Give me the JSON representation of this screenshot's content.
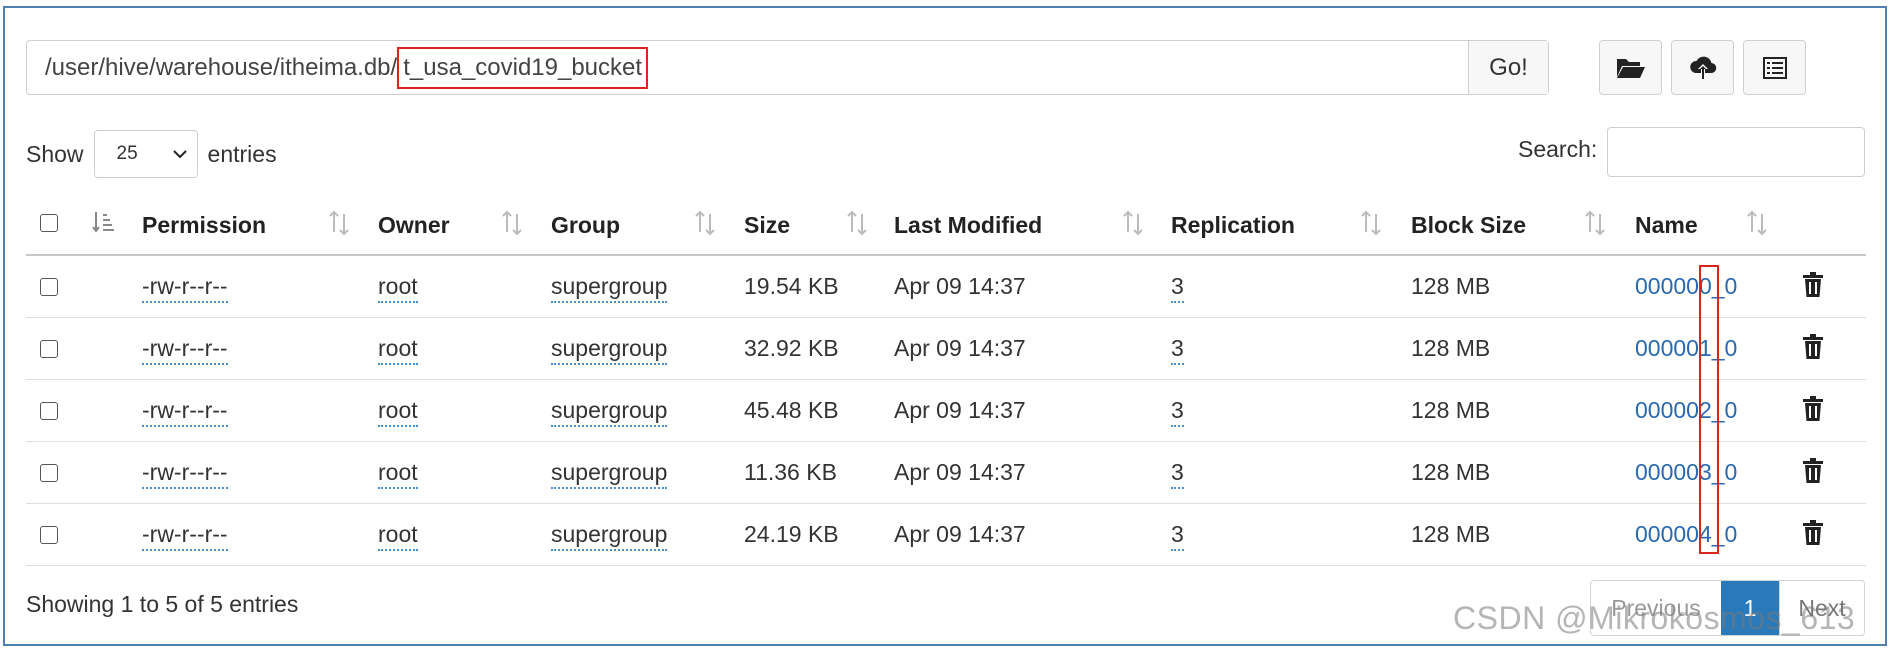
{
  "path": {
    "prefix": "/user/hive/warehouse/itheima.db/",
    "highlighted": "t_usa_covid19_bucket",
    "go_label": "Go!"
  },
  "toolbar": {
    "icons": [
      "folder-open-icon",
      "upload-icon",
      "list-icon"
    ]
  },
  "length": {
    "show_label": "Show",
    "selected": "25",
    "entries_label": "entries"
  },
  "search": {
    "label": "Search:",
    "value": ""
  },
  "table": {
    "headers": [
      "Permission",
      "Owner",
      "Group",
      "Size",
      "Last Modified",
      "Replication",
      "Block Size",
      "Name"
    ],
    "rows": [
      {
        "permission": "-rw-r--r--",
        "owner": "root",
        "group": "supergroup",
        "size": "19.54 KB",
        "modified": "Apr 09 14:37",
        "replication": "3",
        "block_size": "128 MB",
        "name": "000000_0"
      },
      {
        "permission": "-rw-r--r--",
        "owner": "root",
        "group": "supergroup",
        "size": "32.92 KB",
        "modified": "Apr 09 14:37",
        "replication": "3",
        "block_size": "128 MB",
        "name": "000001_0"
      },
      {
        "permission": "-rw-r--r--",
        "owner": "root",
        "group": "supergroup",
        "size": "45.48 KB",
        "modified": "Apr 09 14:37",
        "replication": "3",
        "block_size": "128 MB",
        "name": "000002_0"
      },
      {
        "permission": "-rw-r--r--",
        "owner": "root",
        "group": "supergroup",
        "size": "11.36 KB",
        "modified": "Apr 09 14:37",
        "replication": "3",
        "block_size": "128 MB",
        "name": "000003_0"
      },
      {
        "permission": "-rw-r--r--",
        "owner": "root",
        "group": "supergroup",
        "size": "24.19 KB",
        "modified": "Apr 09 14:37",
        "replication": "3",
        "block_size": "128 MB",
        "name": "000004_0"
      }
    ]
  },
  "footer": {
    "info": "Showing 1 to 5 of 5 entries"
  },
  "pagination": {
    "previous": "Previous",
    "current": "1",
    "next": "Next"
  },
  "watermark": "CSDN @Mikrokosmos_613",
  "colors": {
    "accent": "#2a7ab9",
    "link": "#2a68b0",
    "highlight": "#d9261c",
    "frame": "#4f7fae"
  }
}
